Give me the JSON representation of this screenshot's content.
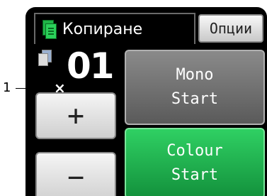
{
  "header": {
    "title": "Копиране",
    "options_label": "Опции",
    "icon": "copy-icon"
  },
  "copies": {
    "multiplier": "×",
    "count": "01",
    "icon": "copies-icon"
  },
  "buttons": {
    "plus_label": "+",
    "minus_label": "−",
    "mono_line1": "Mono",
    "mono_line2": "Start",
    "colour_line1": "Colour",
    "colour_line2": "Start"
  },
  "callout": {
    "number": "1"
  },
  "colors": {
    "screen_bg": "#000000",
    "colour_start": "#1fb447",
    "mono_start": "#6e6e6e",
    "accent_icon": "#2bd15a"
  }
}
